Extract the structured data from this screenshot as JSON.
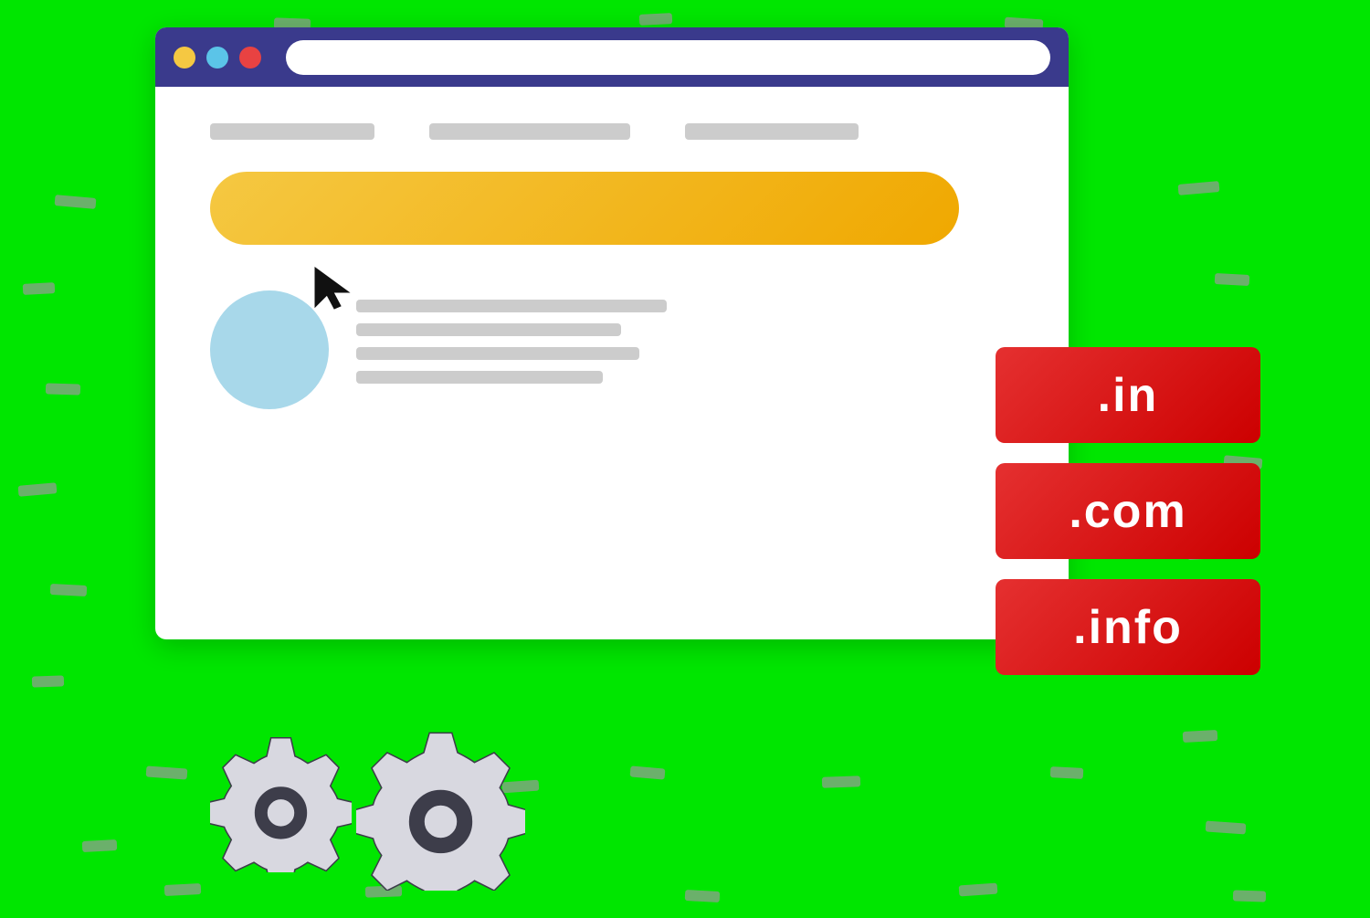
{
  "background": {
    "color": "#00e600"
  },
  "browser": {
    "titlebar_color": "#3a3a8c",
    "btn_yellow": "#f5c842",
    "btn_blue": "#5bc4e8",
    "btn_red": "#e84242",
    "addressbar_bg": "#ffffff"
  },
  "search_bar": {
    "color_start": "#f5c842",
    "color_end": "#f0a800"
  },
  "domain_badges": [
    {
      "label": ".in"
    },
    {
      "label": ".com"
    },
    {
      "label": ".info"
    }
  ],
  "gears": {
    "count": 2,
    "color": "#3d3d4a"
  },
  "dashes": {
    "count": 28
  }
}
